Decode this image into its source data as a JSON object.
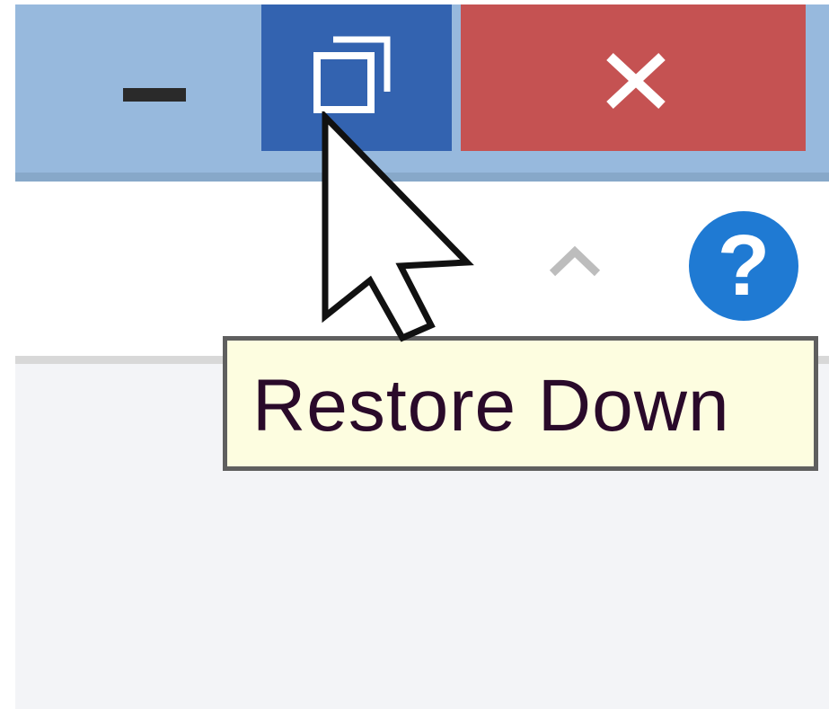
{
  "window": {
    "controls": {
      "minimize_icon": "minimize-icon",
      "restore_icon": "restore-down-icon",
      "close_icon": "close-icon"
    },
    "colors": {
      "titlebar": "#97b9dd",
      "restore_hover": "#3363b0",
      "close": "#c55252",
      "help": "#1f7ad3",
      "tooltip_bg": "#fdfde0"
    }
  },
  "ribbon": {
    "collapse_icon": "chevron-up-icon",
    "help_label": "?"
  },
  "tooltip": {
    "text": "Restore Down"
  }
}
